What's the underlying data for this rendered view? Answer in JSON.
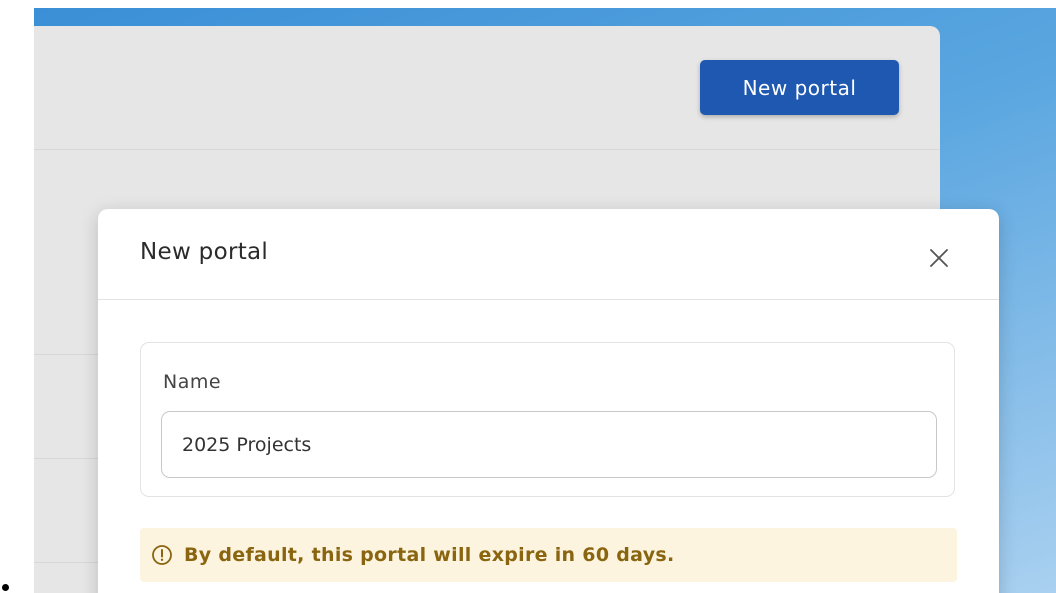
{
  "header": {
    "new_portal_button": "New portal"
  },
  "modal": {
    "title": "New portal",
    "close_icon": "close-icon",
    "name_field": {
      "label": "Name",
      "value": "2025 Projects"
    },
    "notice": {
      "icon": "info-circle-icon",
      "text": "By default, this portal will expire in 60 days."
    }
  },
  "colors": {
    "primary": "#1e58b0",
    "notice_bg": "#fcf4df",
    "notice_text": "#8a6510"
  }
}
